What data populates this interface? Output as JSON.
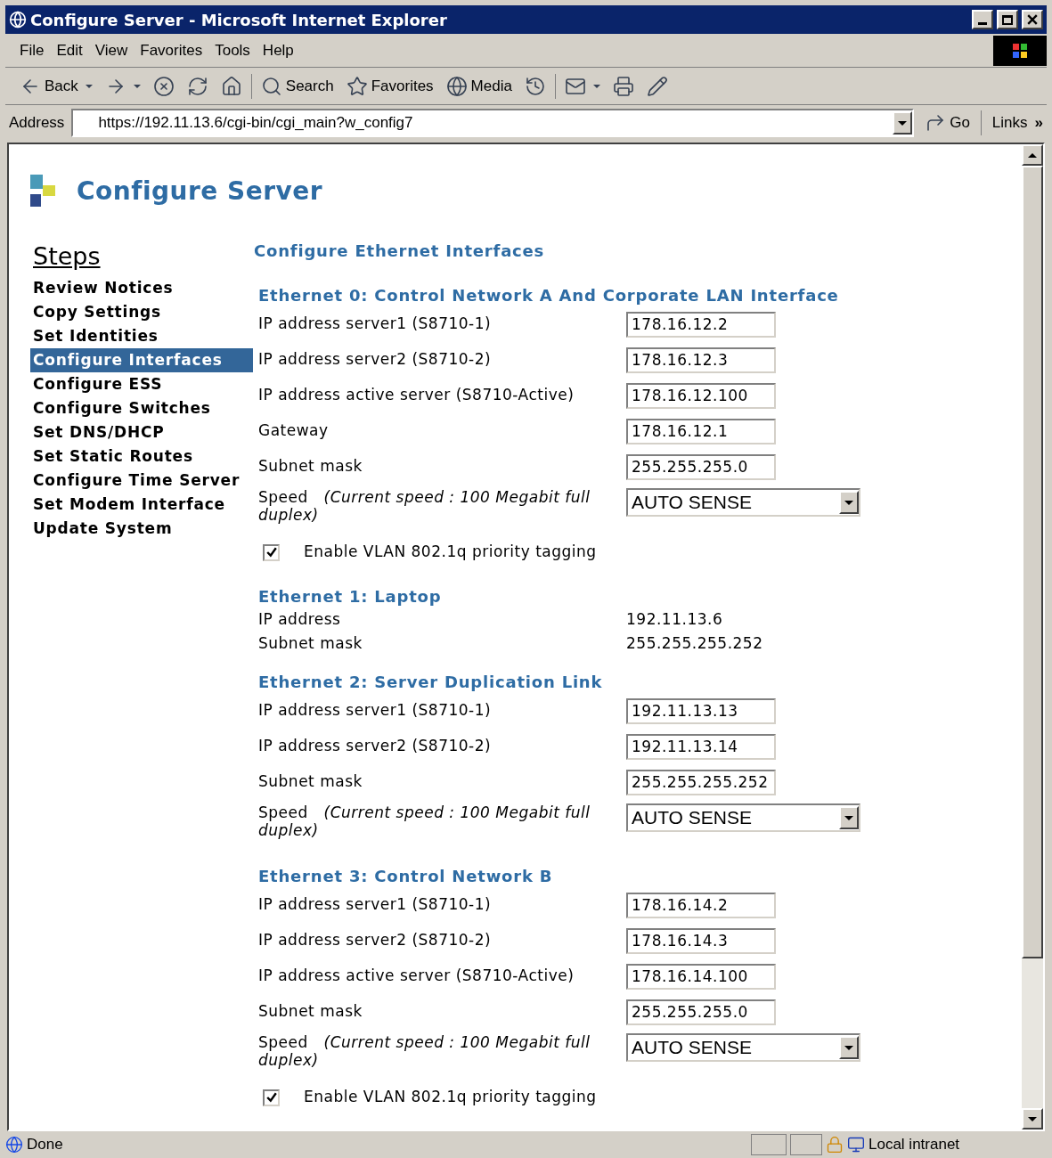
{
  "window": {
    "title": "Configure Server - Microsoft Internet Explorer"
  },
  "menu": [
    "File",
    "Edit",
    "View",
    "Favorites",
    "Tools",
    "Help"
  ],
  "toolbar": {
    "back": "Back",
    "search": "Search",
    "favorites": "Favorites",
    "media": "Media"
  },
  "address_bar": {
    "label": "Address",
    "value": "https://192.11.13.6/cgi-bin/cgi_main?w_config7",
    "go": "Go",
    "links": "Links",
    "more": "»"
  },
  "page": {
    "title": "Configure Server",
    "steps": {
      "heading": "Steps",
      "items": [
        {
          "label": "Review Notices",
          "selected": false
        },
        {
          "label": "Copy Settings",
          "selected": false
        },
        {
          "label": "Set Identities",
          "selected": false
        },
        {
          "label": "Configure Interfaces",
          "selected": true
        },
        {
          "label": "Configure ESS",
          "selected": false
        },
        {
          "label": "Configure Switches",
          "selected": false
        },
        {
          "label": "Set DNS/DHCP",
          "selected": false
        },
        {
          "label": "Set Static Routes",
          "selected": false
        },
        {
          "label": "Configure Time Server",
          "selected": false
        },
        {
          "label": "Set Modem Interface",
          "selected": false
        },
        {
          "label": "Update System",
          "selected": false
        }
      ]
    },
    "heading": "Configure Ethernet Interfaces",
    "sections": [
      {
        "title": "Ethernet 0: Control Network A And Corporate LAN Interface",
        "rows": [
          {
            "kind": "input",
            "label": "IP address server1 (S8710-1)",
            "value": "178.16.12.2"
          },
          {
            "kind": "input",
            "label": "IP address server2 (S8710-2)",
            "value": "178.16.12.3"
          },
          {
            "kind": "input",
            "label": "IP address active server (S8710-Active)",
            "value": "178.16.12.100"
          },
          {
            "kind": "input",
            "label": "Gateway",
            "value": "178.16.12.1"
          },
          {
            "kind": "input",
            "label": "Subnet mask",
            "value": "255.255.255.0"
          },
          {
            "kind": "select",
            "label": "Speed   *(Current speed : 100 Megabit full duplex)*",
            "value": "AUTO SENSE"
          },
          {
            "kind": "checkbox",
            "label": "Enable VLAN 802.1q priority tagging",
            "checked": true
          }
        ]
      },
      {
        "title": "Ethernet 1: Laptop",
        "rows": [
          {
            "kind": "text",
            "label": "IP address",
            "value": "192.11.13.6"
          },
          {
            "kind": "text",
            "label": "Subnet mask",
            "value": "255.255.255.252"
          }
        ]
      },
      {
        "title": "Ethernet 2: Server Duplication Link",
        "rows": [
          {
            "kind": "input",
            "label": "IP address server1 (S8710-1)",
            "value": "192.11.13.13"
          },
          {
            "kind": "input",
            "label": "IP address server2 (S8710-2)",
            "value": "192.11.13.14"
          },
          {
            "kind": "input",
            "label": "Subnet mask",
            "value": "255.255.255.252"
          },
          {
            "kind": "select",
            "label": "Speed   *(Current speed : 100 Megabit full duplex)*",
            "value": "AUTO SENSE"
          }
        ]
      },
      {
        "title": "Ethernet 3: Control Network B",
        "rows": [
          {
            "kind": "input",
            "label": "IP address server1 (S8710-1)",
            "value": "178.16.14.2"
          },
          {
            "kind": "input",
            "label": "IP address server2 (S8710-2)",
            "value": "178.16.14.3"
          },
          {
            "kind": "input",
            "label": "IP address active server (S8710-Active)",
            "value": "178.16.14.100"
          },
          {
            "kind": "input",
            "label": "Subnet mask",
            "value": "255.255.255.0"
          },
          {
            "kind": "select",
            "label": "Speed   *(Current speed : 100 Megabit full duplex)*",
            "value": "AUTO SENSE"
          },
          {
            "kind": "checkbox",
            "label": "Enable VLAN 802.1q priority tagging",
            "checked": true
          }
        ]
      }
    ]
  },
  "status_bar": {
    "text": "Done",
    "zone": "Local intranet"
  }
}
